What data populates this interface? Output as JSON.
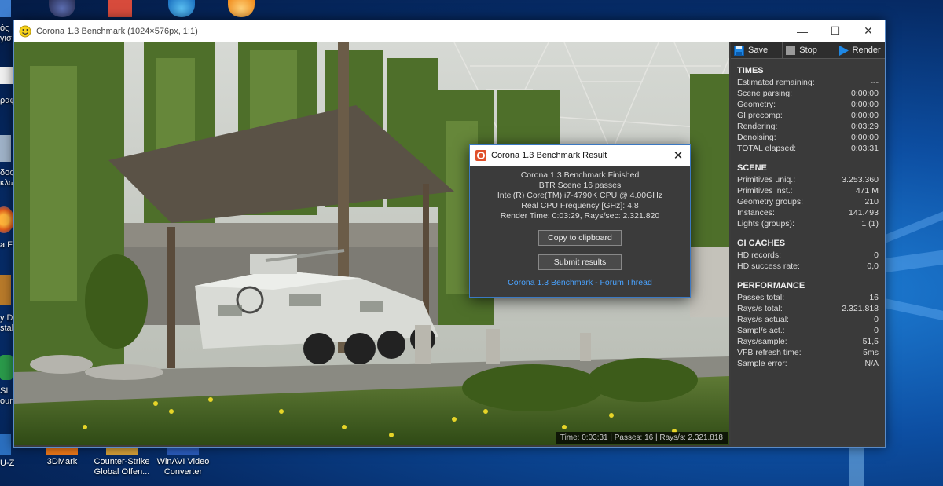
{
  "desktop": {
    "edge_labels": [
      "ός",
      "γισ",
      "ραφ",
      "δος",
      "κλω",
      "a Fir",
      "y Dr",
      "stall",
      "SI",
      "ourn",
      "U-Z"
    ],
    "icons": [
      {
        "name": "3dmark-icon",
        "label": "3DMark"
      },
      {
        "name": "counter-strike-icon",
        "label": "Counter-Strike Global Offen..."
      },
      {
        "name": "winavi-icon",
        "label": "WinAVI Video Converter"
      }
    ]
  },
  "window": {
    "title": "Corona 1.3 Benchmark (1024×576px, 1:1)",
    "min_glyph": "—",
    "max_glyph": "☐",
    "close_glyph": "✕"
  },
  "toolbar": {
    "save_label": "Save",
    "stop_label": "Stop",
    "render_label": "Render"
  },
  "status": "Time: 0:03:31 | Passes: 16 | Rays/s: 2.321.818",
  "times": {
    "heading": "TIMES",
    "rows": [
      {
        "label": "Estimated remaining:",
        "value": "---"
      },
      {
        "label": "Scene parsing:",
        "value": "0:00:00"
      },
      {
        "label": "Geometry:",
        "value": "0:00:00"
      },
      {
        "label": "GI precomp:",
        "value": "0:00:00"
      },
      {
        "label": "Rendering:",
        "value": "0:03:29"
      },
      {
        "label": "Denoising:",
        "value": "0:00:00"
      },
      {
        "label": "TOTAL elapsed:",
        "value": "0:03:31"
      }
    ]
  },
  "scene": {
    "heading": "SCENE",
    "rows": [
      {
        "label": "Primitives uniq.:",
        "value": "3.253.360"
      },
      {
        "label": "Primitives inst.:",
        "value": "471 M"
      },
      {
        "label": "Geometry groups:",
        "value": "210"
      },
      {
        "label": "Instances:",
        "value": "141.493"
      },
      {
        "label": "Lights (groups):",
        "value": "1 (1)"
      }
    ]
  },
  "gi_caches": {
    "heading": "GI CACHES",
    "rows": [
      {
        "label": "HD records:",
        "value": "0"
      },
      {
        "label": "HD success rate:",
        "value": "0,0"
      }
    ]
  },
  "performance": {
    "heading": "PERFORMANCE",
    "rows": [
      {
        "label": "Passes total:",
        "value": "16"
      },
      {
        "label": "Rays/s total:",
        "value": "2.321.818"
      },
      {
        "label": "Rays/s actual:",
        "value": "0"
      },
      {
        "label": "Sampl/s act.:",
        "value": "0"
      },
      {
        "label": "Rays/sample:",
        "value": "51,5"
      },
      {
        "label": "VFB refresh time:",
        "value": "5ms"
      },
      {
        "label": "Sample error:",
        "value": "N/A"
      }
    ]
  },
  "dialog": {
    "title": "Corona 1.3 Benchmark Result",
    "close_glyph": "✕",
    "lines": [
      "Corona 1.3 Benchmark Finished",
      "BTR Scene 16 passes",
      "Intel(R) Core(TM) i7-4790K CPU @ 4.00GHz",
      "Real CPU Frequency [GHz]: 4.8",
      "Render Time: 0:03:29, Rays/sec: 2.321.820"
    ],
    "copy_label": "Copy to clipboard",
    "submit_label": "Submit results",
    "link_label": "Corona 1.3 Benchmark - Forum Thread"
  }
}
